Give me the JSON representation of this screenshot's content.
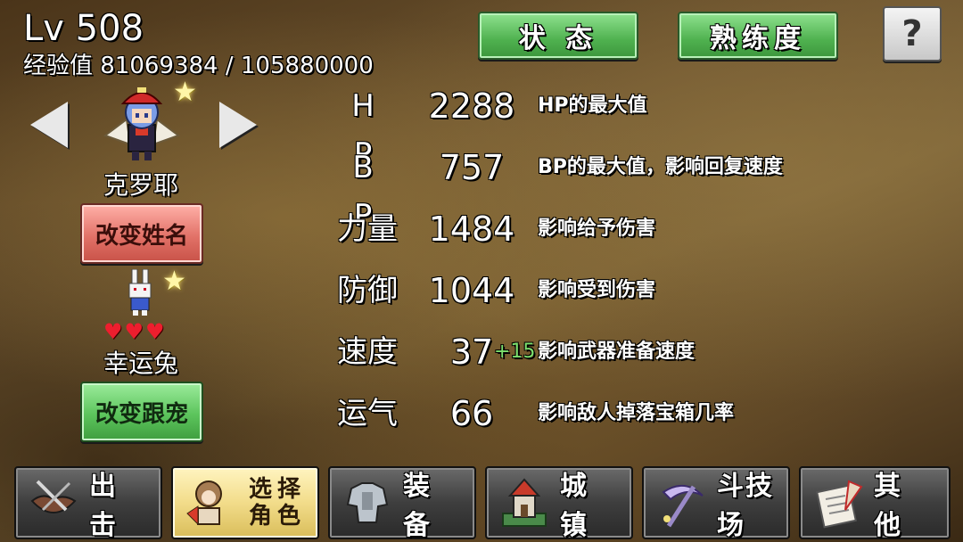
{
  "header": {
    "level": "Lv 508",
    "exp": "经验值 81069384 / 105880000"
  },
  "top_buttons": {
    "status": "状 态",
    "proficiency": "熟练度",
    "help": "?"
  },
  "character": {
    "name": "克罗耶",
    "rename_button": "改变姓名"
  },
  "pet": {
    "name": "幸运兔",
    "hearts": "♥♥♥",
    "change_button": "改变跟宠"
  },
  "stats": [
    {
      "label": "H P",
      "value": "2288",
      "bonus": "",
      "desc": "HP的最大值"
    },
    {
      "label": "B P",
      "value": "757",
      "bonus": "",
      "desc": "BP的最大值，影响回复速度"
    },
    {
      "label": "力量",
      "value": "1484",
      "bonus": "",
      "desc": "影响给予伤害"
    },
    {
      "label": "防御",
      "value": "1044",
      "bonus": "",
      "desc": "影响受到伤害"
    },
    {
      "label": "速度",
      "value": "37",
      "bonus": "+15",
      "desc": "影响武器准备速度"
    },
    {
      "label": "运气",
      "value": "66",
      "bonus": "",
      "desc": "影响敌人掉落宝箱几率"
    }
  ],
  "nav": {
    "attack": "出 击",
    "select_character": "选择角色",
    "equipment": "装 备",
    "town": "城 镇",
    "arena": "斗技场",
    "other": "其 他"
  },
  "icons": {
    "prev": "arrow-left-icon",
    "next": "arrow-right-icon",
    "star": "star-icon",
    "heart": "heart-icon"
  },
  "colors": {
    "status_green": "#4fb14f",
    "rename_red": "#e27268",
    "bonus_green": "#7de06e",
    "heart_red": "#ee1e2e"
  }
}
